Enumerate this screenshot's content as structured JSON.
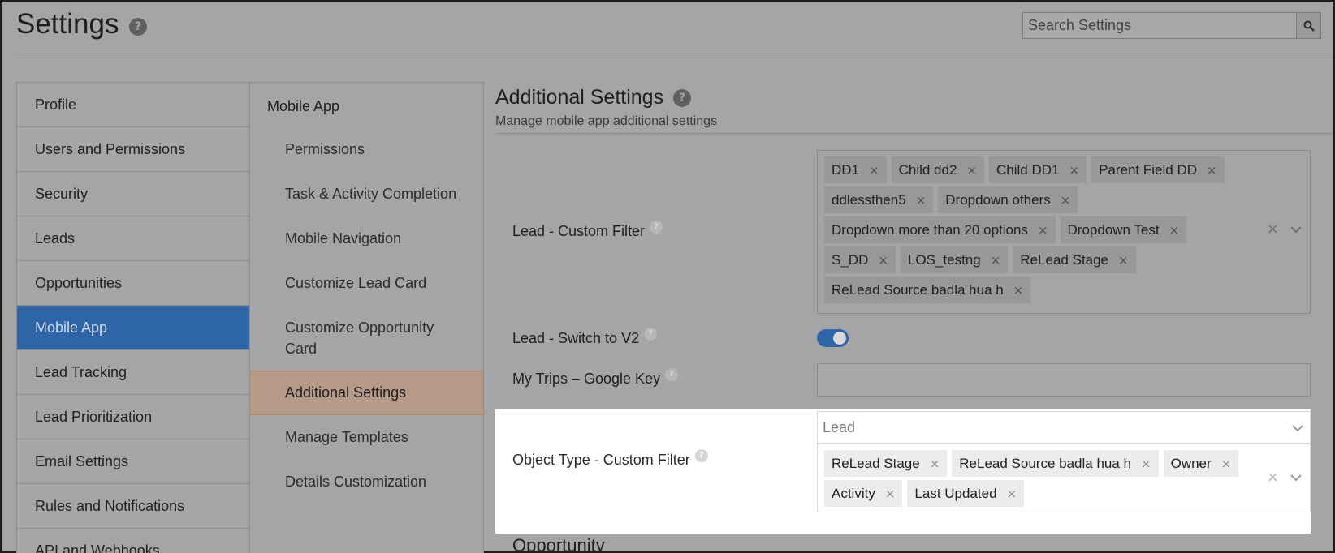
{
  "header": {
    "title": "Settings",
    "search_placeholder": "Search Settings"
  },
  "sidebar": {
    "items": [
      {
        "label": "Profile"
      },
      {
        "label": "Users and Permissions"
      },
      {
        "label": "Security"
      },
      {
        "label": "Leads"
      },
      {
        "label": "Opportunities"
      },
      {
        "label": "Mobile App",
        "active": true
      },
      {
        "label": "Lead Tracking"
      },
      {
        "label": "Lead Prioritization"
      },
      {
        "label": "Email Settings"
      },
      {
        "label": "Rules and Notifications"
      },
      {
        "label": "API and Webhooks"
      }
    ]
  },
  "subnav": {
    "heading": "Mobile App",
    "items": [
      {
        "label": "Permissions"
      },
      {
        "label": "Task & Activity Completion"
      },
      {
        "label": "Mobile Navigation"
      },
      {
        "label": "Customize Lead Card"
      },
      {
        "label": "Customize Opportunity Card"
      },
      {
        "label": "Additional Settings",
        "active": true
      },
      {
        "label": "Manage Templates"
      },
      {
        "label": "Details Customization"
      }
    ]
  },
  "main": {
    "title": "Additional Settings",
    "subtitle": "Manage mobile app additional settings",
    "lead_custom_filter": {
      "label": "Lead - Custom Filter",
      "chips": [
        "DD1",
        "Child dd2",
        "Child DD1",
        "Parent Field DD",
        "ddlessthen5",
        "Dropdown others",
        "Dropdown more than 20 options",
        "Dropdown Test",
        "S_DD",
        "LOS_testng",
        "ReLead Stage",
        "ReLead Source badla hua h"
      ]
    },
    "lead_switch_v2": {
      "label": "Lead - Switch to V2",
      "enabled": true
    },
    "my_trips_key": {
      "label": "My Trips – Google Key",
      "value": ""
    },
    "object_type_filter": {
      "label": "Object Type - Custom Filter",
      "selected_object": "Lead",
      "chips": [
        "ReLead Stage",
        "ReLead Source badla hua h",
        "Owner",
        "Activity",
        "Last Updated"
      ]
    },
    "next_section_heading": "Opportunity"
  },
  "icons": {
    "help": "question-circle-icon",
    "search": "search-icon",
    "chip_remove": "close-icon",
    "clear": "clear-icon",
    "dropdown": "chevron-down-icon"
  },
  "colors": {
    "accent": "#2e64a8",
    "active_subnav_border": "#b9845a"
  }
}
